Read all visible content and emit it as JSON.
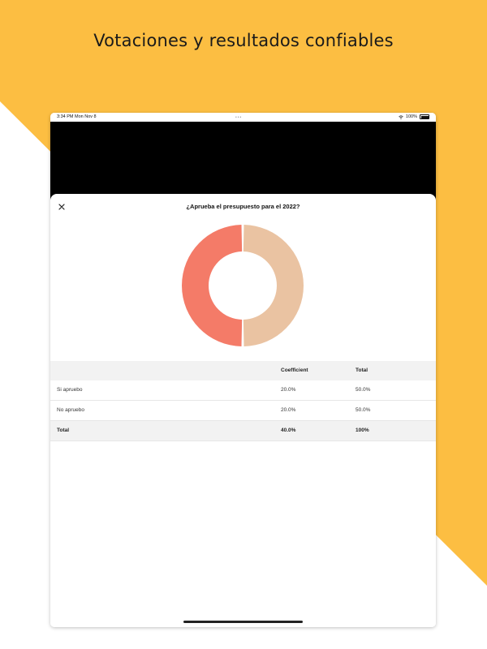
{
  "headline": "Votaciones y resultados confiables",
  "colors": {
    "brand_yellow": "#FCBE42",
    "slice_si": "#F47B68",
    "slice_no": "#EAC3A2"
  },
  "statusbar": {
    "time": "3:34 PM   Mon Nov 8",
    "battery": "100%"
  },
  "modal": {
    "title": "¿Aprueba el presupuesto para el 2022?",
    "close_icon": "close-icon"
  },
  "chart_data": {
    "type": "pie",
    "labels": [
      "Si apruebo",
      "No apruebo"
    ],
    "values": [
      50,
      50
    ]
  },
  "table": {
    "headers": [
      "",
      "Coefficient",
      "Total"
    ],
    "rows": [
      [
        "Si apruebo",
        "20.0%",
        "50.0%"
      ],
      [
        "No apruebo",
        "20.0%",
        "50.0%"
      ]
    ],
    "total": [
      "Total",
      "40.0%",
      "100%"
    ]
  }
}
